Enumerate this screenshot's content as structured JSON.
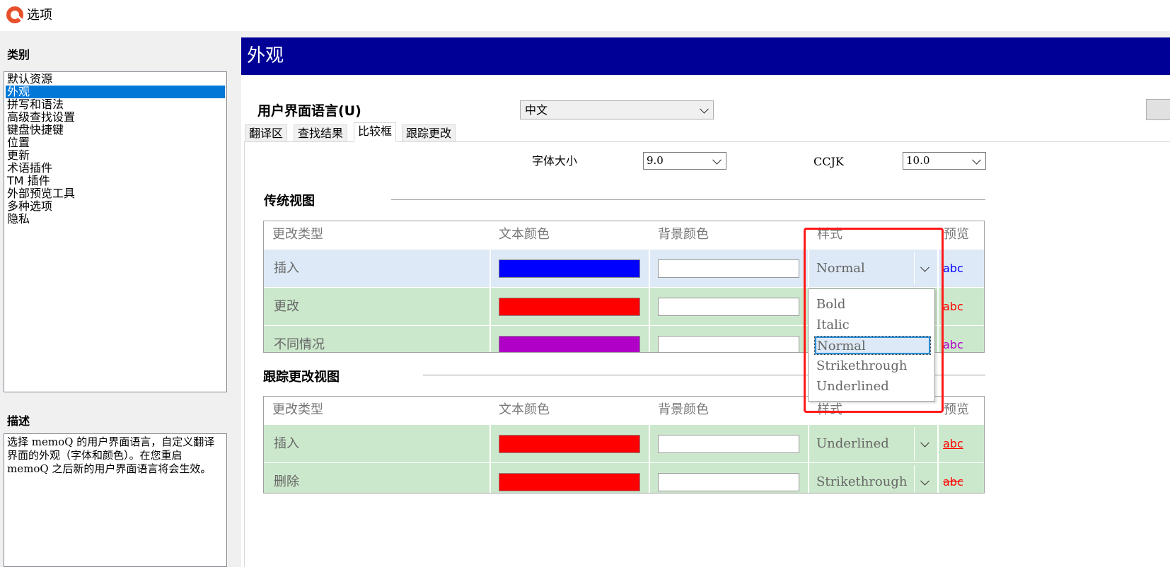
{
  "window": {
    "title": "选项"
  },
  "left": {
    "category_label": "类别",
    "categories": [
      "默认资源",
      "外观",
      "拼写和语法",
      "高级查找设置",
      "键盘快捷键",
      "位置",
      "更新",
      "术语插件",
      "TM 插件",
      "外部预览工具",
      "多种选项",
      "隐私"
    ],
    "selected_index": 1,
    "description_label": "描述",
    "description_text": "选择 memoQ 的用户界面语言，自定义翻译界面的外观（字体和颜色）。在您重启 memoQ 之后新的用户界面语言将会生效。"
  },
  "main": {
    "section_title": "外观",
    "ui_language_label": "用户界面语言(U)",
    "ui_language_value": "中文",
    "tabs": [
      {
        "label": "翻译区",
        "active": false
      },
      {
        "label": "查找结果",
        "active": false
      },
      {
        "label": "比较框",
        "active": true
      },
      {
        "label": "跟踪更改",
        "active": false
      }
    ],
    "font_size_label": "字体大小",
    "font_size_value": "9.0",
    "ccjk_label": "CCJK",
    "ccjk_value": "10.0",
    "traditional": {
      "title": "传统视图",
      "headers": [
        "更改类型",
        "文本颜色",
        "背景颜色",
        "样式",
        "预览"
      ],
      "rows": [
        {
          "type": "插入",
          "text_color": "#0000ff",
          "style": "Normal",
          "preview": "abc",
          "preview_color": "#0000ff"
        },
        {
          "type": "更改",
          "text_color": "#ff0000",
          "style": "",
          "preview": "abc",
          "preview_color": "#ff0000"
        },
        {
          "type": "不同情况",
          "text_color": "#b000c8",
          "style": "",
          "preview": "abc",
          "preview_color": "#b000c8"
        }
      ]
    },
    "tracked": {
      "title": "跟踪更改视图",
      "headers": [
        "更改类型",
        "文本颜色",
        "背景颜色",
        "样式",
        "预览"
      ],
      "rows": [
        {
          "type": "插入",
          "text_color": "#ff0000",
          "style": "Underlined",
          "preview": "abc",
          "preview_color": "#ff0000"
        },
        {
          "type": "删除",
          "text_color": "#ff0000",
          "style": "Strikethrough",
          "preview": "abc",
          "preview_color": "#ff0000"
        }
      ]
    },
    "style_dropdown": {
      "options": [
        "Bold",
        "Italic",
        "Normal",
        "Strikethrough",
        "Underlined"
      ],
      "highlighted": "Normal"
    }
  },
  "colors": {
    "header_bg": "#000096",
    "selection": "#0078d7",
    "highlight_box": "#ff1a1a"
  }
}
